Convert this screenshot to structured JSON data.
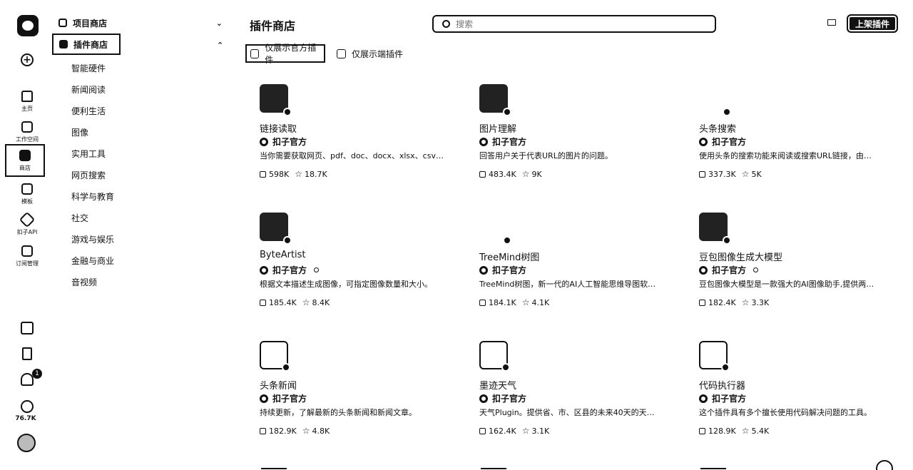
{
  "rail": {
    "items": [
      {
        "label": "主页",
        "icon": "home-icon"
      },
      {
        "label": "工作空间",
        "icon": "workspace-icon"
      },
      {
        "label": "商店",
        "icon": "store-icon"
      },
      {
        "label": "模板",
        "icon": "template-icon"
      },
      {
        "label": "扣子API",
        "icon": "api-icon"
      },
      {
        "label": "订阅管理",
        "icon": "subscription-icon"
      }
    ],
    "notifications_badge": "1",
    "coins": "76.7K"
  },
  "categories": {
    "project_store": "项目商店",
    "plugin_store": "插件商店",
    "subs": [
      "智能硬件",
      "新闻阅读",
      "便利生活",
      "图像",
      "实用工具",
      "网页搜索",
      "科学与教育",
      "社交",
      "游戏与娱乐",
      "金融与商业",
      "音视频"
    ]
  },
  "header": {
    "title": "插件商店",
    "search_placeholder": "搜索",
    "publish_label": "上架插件"
  },
  "filters": {
    "official_only": "仅展示官方插件",
    "client_only": "仅展示端插件"
  },
  "plugins": [
    {
      "name": "链接读取",
      "author": "扣子官方",
      "verified": false,
      "desc": "当你需要获取网页、pdf、doc、docx、xlsx、csv…",
      "uses": "598K",
      "stars": "18.7K",
      "icon": "link-reader-icon"
    },
    {
      "name": "图片理解",
      "author": "扣子官方",
      "verified": false,
      "desc": "回答用户关于代表URL的图片的问题。",
      "uses": "483.4K",
      "stars": "9K",
      "icon": "image-understanding-icon"
    },
    {
      "name": "头条搜索",
      "author": "扣子官方",
      "verified": false,
      "desc": "使用头条的搜索功能来阅读或搜索URL链接，由…",
      "uses": "337.3K",
      "stars": "5K",
      "icon": "toutiao-search-icon"
    },
    {
      "name": "ByteArtist",
      "author": "扣子官方",
      "verified": true,
      "desc": "根据文本描述生成图像，可指定图像数量和大小。",
      "uses": "185.4K",
      "stars": "8.4K",
      "icon": "byteartist-icon"
    },
    {
      "name": "TreeMind树图",
      "author": "扣子官方",
      "verified": false,
      "desc": "TreeMind树图，新一代的AI人工智能思维导图软…",
      "uses": "184.1K",
      "stars": "4.1K",
      "icon": "treemind-icon"
    },
    {
      "name": "豆包图像生成大模型",
      "author": "扣子官方",
      "verified": true,
      "desc": "豆包图像大模型是一款强大的AI图像助手,提供两…",
      "uses": "182.4K",
      "stars": "3.3K",
      "icon": "doubao-image-icon"
    },
    {
      "name": "头条新闻",
      "author": "扣子官方",
      "verified": false,
      "desc": "持续更新，了解最新的头条新闻和新闻文章。",
      "uses": "182.9K",
      "stars": "4.8K",
      "icon": "toutiao-news-icon"
    },
    {
      "name": "墨迹天气",
      "author": "扣子官方",
      "verified": false,
      "desc": "天气Plugin。提供省、市、区县的未来40天的天…",
      "uses": "162.4K",
      "stars": "3.1K",
      "icon": "weather-icon"
    },
    {
      "name": "代码执行器",
      "author": "扣子官方",
      "verified": false,
      "desc": "这个插件具有多个擅长使用代码解决问题的工具。",
      "uses": "128.9K",
      "stars": "5.4K",
      "icon": "code-runner-icon"
    }
  ]
}
